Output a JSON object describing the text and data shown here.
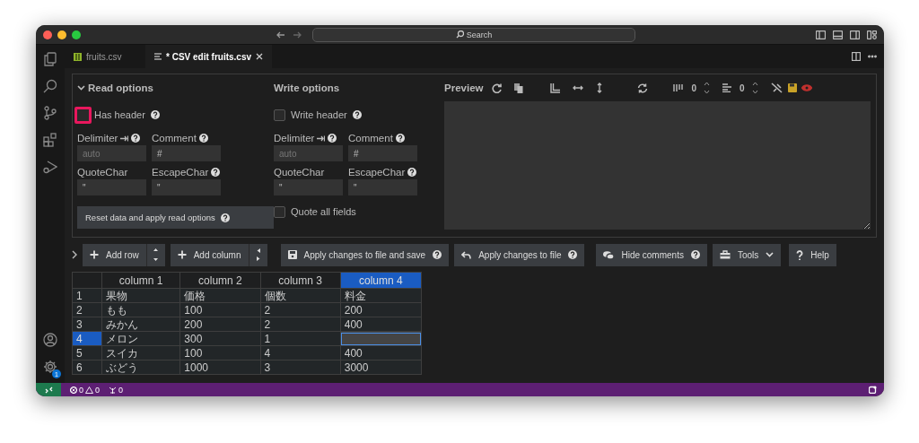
{
  "title_bar": {
    "search_placeholder": "Search"
  },
  "activity_bar": {
    "settings_badge": "1"
  },
  "tabs": [
    {
      "label": "fruits.csv",
      "selected": false,
      "kind": "file"
    },
    {
      "label": "* CSV edit fruits.csv",
      "selected": true,
      "kind": "editor"
    }
  ],
  "read_options": {
    "title": "Read options",
    "expanded": true,
    "header_checkbox": {
      "label": "Has header",
      "checked": false,
      "highlighted": true
    },
    "fields": [
      {
        "label": "Delimiter",
        "placeholder": "auto",
        "kind": "delimiter"
      },
      {
        "label": "Comment",
        "value": "#",
        "kind": "help"
      },
      {
        "label": "QuoteChar",
        "value": "\"",
        "kind": "plain"
      },
      {
        "label": "EscapeChar",
        "value": "\"",
        "kind": "help"
      }
    ],
    "reset_button": "Reset data and apply read options"
  },
  "write_options": {
    "title": "Write options",
    "header_checkbox": {
      "label": "Write header",
      "checked": false,
      "highlighted": false
    },
    "fields": [
      {
        "label": "Delimiter",
        "placeholder": "auto",
        "kind": "delimiter"
      },
      {
        "label": "Comment",
        "value": "#",
        "kind": "help"
      },
      {
        "label": "QuoteChar",
        "value": "\"",
        "kind": "plain"
      },
      {
        "label": "EscapeChar",
        "value": "\"",
        "kind": "help"
      }
    ],
    "quote_all_checkbox": {
      "label": "Quote all fields",
      "checked": false,
      "highlighted": false
    }
  },
  "preview": {
    "title": "Preview",
    "column_count": "0",
    "row_count": "0"
  },
  "toolbar": {
    "expanded": false,
    "buttons": [
      {
        "label": "Add row",
        "kind": "add-row"
      },
      {
        "label": "Add column",
        "kind": "add-column"
      },
      {
        "label": "Apply changes to file and save",
        "kind": "save"
      },
      {
        "label": "Apply changes to file",
        "kind": "apply"
      },
      {
        "label": "Hide comments",
        "kind": "comments"
      },
      {
        "label": "Tools",
        "kind": "tools"
      },
      {
        "label": "Help",
        "kind": "help"
      }
    ]
  },
  "table": {
    "columns": [
      {
        "label": "column 1",
        "selected": false
      },
      {
        "label": "column 2",
        "selected": false
      },
      {
        "label": "column 3",
        "selected": false
      },
      {
        "label": "column 4",
        "selected": true
      }
    ],
    "rows": [
      {
        "number": "1",
        "selected": false,
        "editing": false,
        "cells": [
          "果物",
          "価格",
          "個数",
          "料金"
        ]
      },
      {
        "number": "2",
        "selected": false,
        "editing": false,
        "cells": [
          "もも",
          "100",
          "2",
          "200"
        ]
      },
      {
        "number": "3",
        "selected": false,
        "editing": false,
        "cells": [
          "みかん",
          "200",
          "2",
          "400"
        ]
      },
      {
        "number": "4",
        "selected": true,
        "editing": true,
        "cells": [
          "メロン",
          "300",
          "1"
        ]
      },
      {
        "number": "5",
        "selected": false,
        "editing": false,
        "cells": [
          "スイカ",
          "100",
          "4",
          "400"
        ]
      },
      {
        "number": "6",
        "selected": false,
        "editing": false,
        "cells": [
          "ぶどう",
          "1000",
          "3",
          "3000"
        ]
      }
    ]
  },
  "status_bar": {
    "errors": "0",
    "warnings": "0",
    "ports": "0"
  }
}
